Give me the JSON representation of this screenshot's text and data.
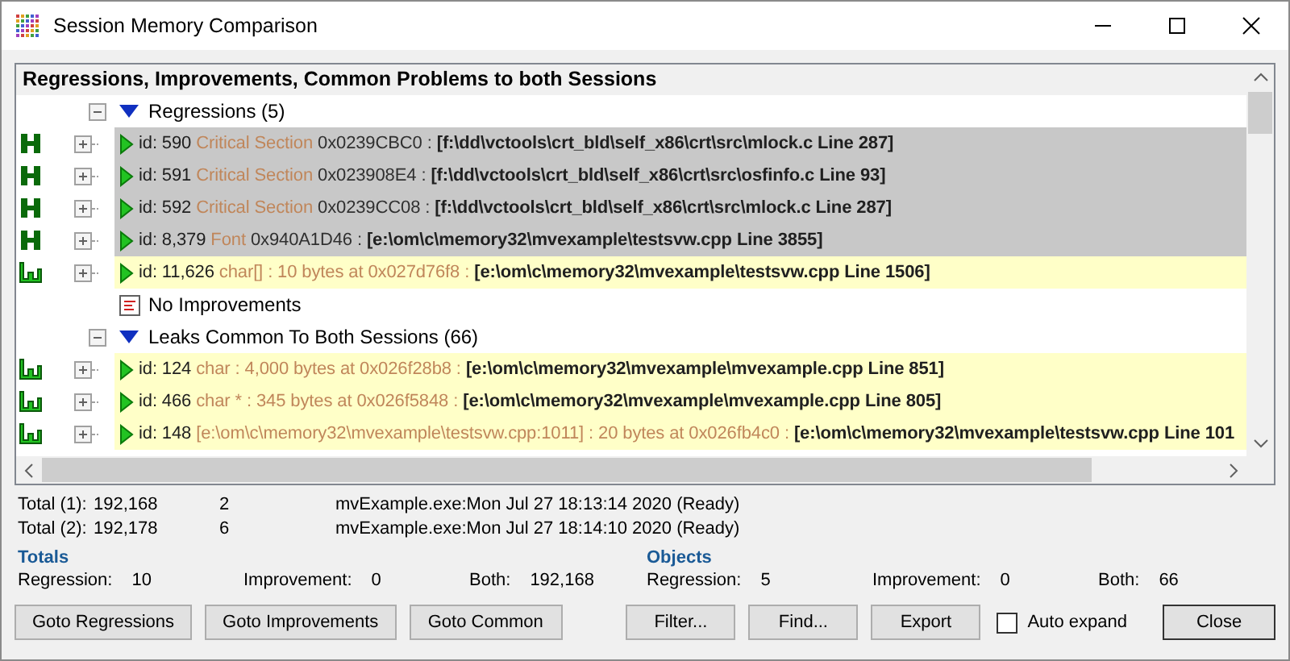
{
  "window": {
    "title": "Session Memory Comparison"
  },
  "tree": {
    "header": "Regressions, Improvements, Common Problems to both Sessions",
    "groups": [
      {
        "kind": "group",
        "label": "Regressions (5)",
        "expanded": true,
        "children": [
          {
            "kind": "handle",
            "expanded": false,
            "id": "id: 590",
            "type": "Critical Section",
            "detail": "0x0239CBC0 :",
            "location": "[f:\\dd\\vctools\\crt_bld\\self_x86\\crt\\src\\mlock.c Line 287]"
          },
          {
            "kind": "handle",
            "expanded": false,
            "id": "id: 591",
            "type": "Critical Section",
            "detail": "0x023908E4 :",
            "location": "[f:\\dd\\vctools\\crt_bld\\self_x86\\crt\\src\\osfinfo.c Line 93]"
          },
          {
            "kind": "handle",
            "expanded": false,
            "id": "id: 592",
            "type": "Critical Section",
            "detail": "0x0239CC08 :",
            "location": "[f:\\dd\\vctools\\crt_bld\\self_x86\\crt\\src\\mlock.c Line 287]"
          },
          {
            "kind": "handle",
            "expanded": false,
            "id": "id: 8,379",
            "type": "Font",
            "detail": "0x940A1D46 :",
            "location": "[e:\\om\\c\\memory32\\mvexample\\testsvw.cpp Line 3855]"
          },
          {
            "kind": "memory",
            "expanded": false,
            "id": "id: 11,626",
            "type": "char[]",
            "detail": ": 10 bytes at 0x027d76f8 :",
            "location": "[e:\\om\\c\\memory32\\mvexample\\testsvw.cpp Line 1506]"
          }
        ]
      },
      {
        "kind": "empty",
        "label": "No Improvements"
      },
      {
        "kind": "group",
        "label": "Leaks Common To Both Sessions (66)",
        "expanded": true,
        "children": [
          {
            "kind": "memory",
            "expanded": false,
            "id": "id: 124",
            "type": "char",
            "detail": ": 4,000 bytes at 0x026f28b8 :",
            "location": "[e:\\om\\c\\memory32\\mvexample\\mvexample.cpp Line 851]"
          },
          {
            "kind": "memory",
            "expanded": false,
            "id": "id: 466",
            "type": "char *",
            "detail": ": 345 bytes at 0x026f5848 :",
            "location": "[e:\\om\\c\\memory32\\mvexample\\mvexample.cpp Line 805]"
          },
          {
            "kind": "memory",
            "expanded": false,
            "id": "id: 148",
            "type": "[e:\\om\\c\\memory32\\mvexample\\testsvw.cpp:1011]",
            "detail": ": 20 bytes at 0x026fb4c0 :",
            "location": "[e:\\om\\c\\memory32\\mvexample\\testsvw.cpp Line 101"
          }
        ]
      }
    ]
  },
  "sessions": [
    {
      "label": "Total (1):",
      "bytes": "192,168",
      "count": "2",
      "info": "mvExample.exe:Mon Jul 27 18:13:14 2020 (Ready)"
    },
    {
      "label": "Total (2):",
      "bytes": "192,178",
      "count": "6",
      "info": "mvExample.exe:Mon Jul 27 18:14:10 2020 (Ready)"
    }
  ],
  "summaries": [
    {
      "title": "Totals",
      "stats": [
        {
          "label": "Regression:",
          "value": "10"
        },
        {
          "label": "Improvement:",
          "value": "0"
        },
        {
          "label": "Both:",
          "value": "192,168"
        }
      ]
    },
    {
      "title": "Objects",
      "stats": [
        {
          "label": "Regression:",
          "value": "5"
        },
        {
          "label": "Improvement:",
          "value": "0"
        },
        {
          "label": "Both:",
          "value": "66"
        }
      ]
    }
  ],
  "goto_buttons": [
    "Goto Regressions",
    "Goto Improvements",
    "Goto Common"
  ],
  "action_buttons": [
    "Filter...",
    "Find...",
    "Export"
  ],
  "auto_expand": {
    "label": "Auto expand",
    "checked": false
  },
  "close_button": "Close"
}
